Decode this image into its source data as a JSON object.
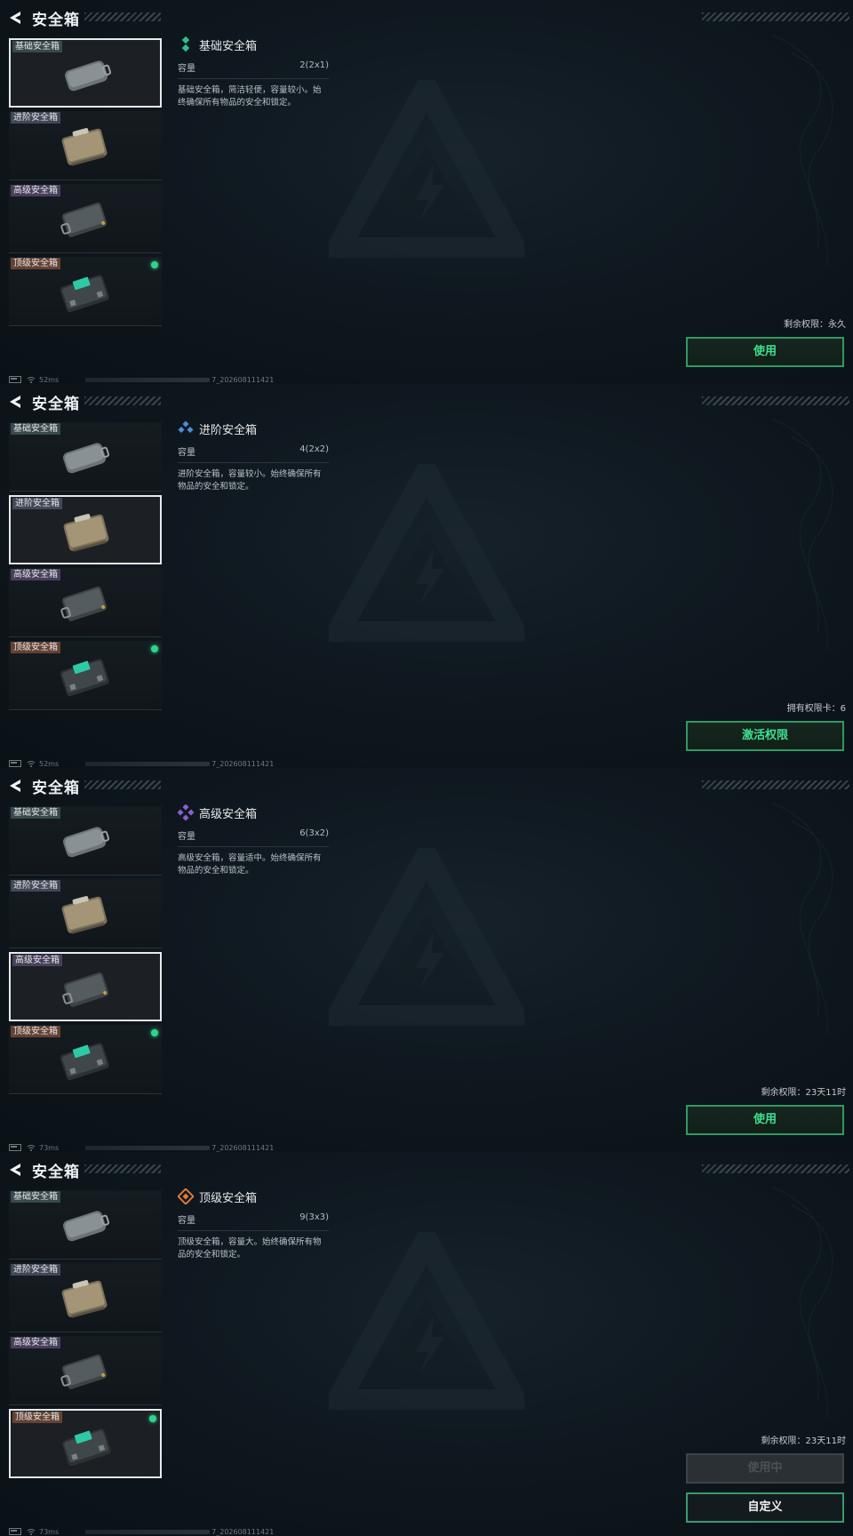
{
  "screens": [
    {
      "title": "安全箱",
      "list": [
        "基础安全箱",
        "进阶安全箱",
        "高级安全箱",
        "顶级安全箱"
      ],
      "selected_index": 0,
      "detail": {
        "name": "基础安全箱",
        "capacity_label": "容量",
        "capacity_value": "2(2x1)",
        "description": "基础安全箱，简洁轻便，容量较小。始终确保所有物品的安全和锁定。"
      },
      "status": "剩余权限：永久",
      "buttons": [
        {
          "label": "使用",
          "state": "active"
        }
      ],
      "footer": {
        "ping": "52ms",
        "code": "7_202608111421"
      }
    },
    {
      "title": "安全箱",
      "list": [
        "基础安全箱",
        "进阶安全箱",
        "高级安全箱",
        "顶级安全箱"
      ],
      "selected_index": 1,
      "detail": {
        "name": "进阶安全箱",
        "capacity_label": "容量",
        "capacity_value": "4(2x2)",
        "description": "进阶安全箱，容量较小。始终确保所有物品的安全和锁定。"
      },
      "status": "拥有权限卡：6",
      "buttons": [
        {
          "label": "激活权限",
          "state": "active"
        }
      ],
      "footer": {
        "ping": "52ms",
        "code": "7_202608111421"
      }
    },
    {
      "title": "安全箱",
      "list": [
        "基础安全箱",
        "进阶安全箱",
        "高级安全箱",
        "顶级安全箱"
      ],
      "selected_index": 2,
      "detail": {
        "name": "高级安全箱",
        "capacity_label": "容量",
        "capacity_value": "6(3x2)",
        "description": "高级安全箱，容量适中。始终确保所有物品的安全和锁定。"
      },
      "status": "剩余权限：23天11时",
      "buttons": [
        {
          "label": "使用",
          "state": "active"
        }
      ],
      "footer": {
        "ping": "73ms",
        "code": "7_202608111421"
      }
    },
    {
      "title": "安全箱",
      "list": [
        "基础安全箱",
        "进阶安全箱",
        "高级安全箱",
        "顶级安全箱"
      ],
      "selected_index": 3,
      "detail": {
        "name": "顶级安全箱",
        "capacity_label": "容量",
        "capacity_value": "9(3x3)",
        "description": "顶级安全箱，容量大。始终确保所有物品的安全和锁定。"
      },
      "status": "剩余权限：23天11时",
      "buttons": [
        {
          "label": "使用中",
          "state": "disabled"
        },
        {
          "label": "自定义",
          "state": "active-white"
        }
      ],
      "footer": {
        "ping": "73ms",
        "code": "7_202608111421"
      }
    }
  ],
  "rarity_colors": [
    "#2fbf8a",
    "#4a8fd8",
    "#8b5fd0",
    "#e07a3a"
  ],
  "active_dot_color": "#2fd58a",
  "accent_color": "#3ee08e"
}
